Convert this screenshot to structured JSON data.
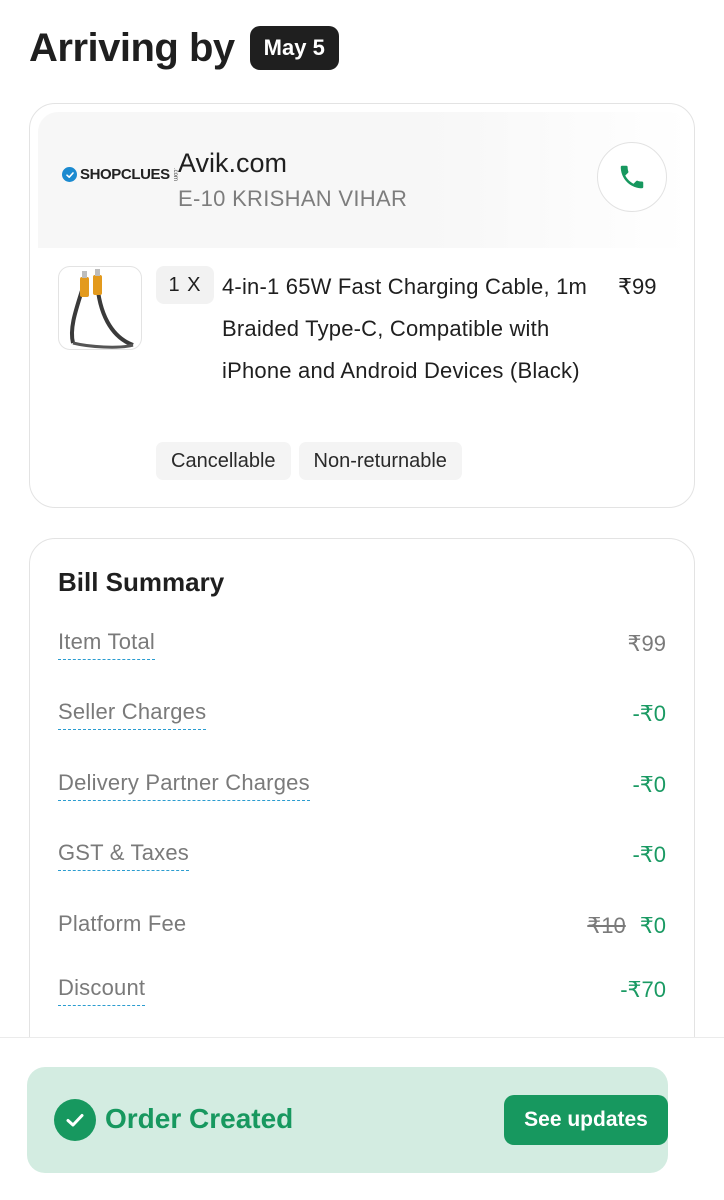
{
  "header": {
    "title": "Arriving by",
    "date": "May 5"
  },
  "store": {
    "logo_text": "SHOPCLUES",
    "logo_suffix": ".com",
    "name": "Avik.com",
    "address": "E-10 KRISHAN VIHAR",
    "call_icon": "phone-icon"
  },
  "item": {
    "quantity": "1 X",
    "name": "4-in-1 65W Fast Charging Cable, 1m Braided Type-C, Compatible with iPhone and Android Devices (Black)",
    "price": "₹99",
    "tags": [
      "Cancellable",
      "Non-returnable"
    ]
  },
  "bill": {
    "title": "Bill Summary",
    "rows": [
      {
        "label": "Item Total",
        "value": "₹99"
      },
      {
        "label": "Seller Charges",
        "value": "-₹0"
      },
      {
        "label": "Delivery Partner Charges",
        "value": "-₹0"
      },
      {
        "label": "GST & Taxes",
        "value": "-₹0"
      },
      {
        "label": "Platform Fee",
        "original": "₹10",
        "value": "₹0"
      },
      {
        "label": "Discount",
        "value": "-₹70"
      }
    ]
  },
  "status": {
    "text": "Order Created",
    "button": "See updates"
  },
  "colors": {
    "accent_green": "#17985f",
    "status_bg": "#d3ece1",
    "dashed_underline": "#2a9cd0"
  }
}
